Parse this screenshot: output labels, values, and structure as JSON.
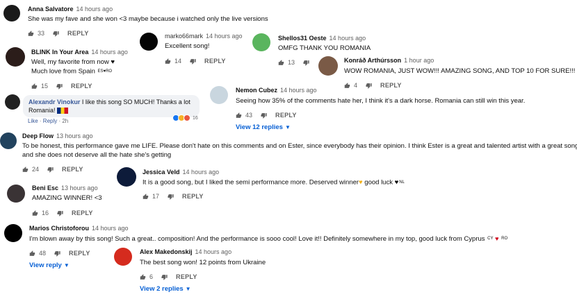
{
  "comments": [
    {
      "author": "Anna Salvatore",
      "time": "14 hours ago",
      "text": "She was my fave and she won <3 maybe because i watched only the live versions",
      "likes": "33",
      "reply": "REPLY"
    },
    {
      "author": "marko66mark",
      "time": "14 hours ago",
      "text": "Excellent song!",
      "likes": "14",
      "reply": "REPLY"
    },
    {
      "author": "Shellos31 Oeste",
      "time": "14 hours ago",
      "text": "OMFG THANK YOU ROMANIA",
      "likes": "13",
      "reply": ""
    },
    {
      "author": "BLINK In Your Area",
      "time": "14 hours ago",
      "text": "Well, my favorite from now ♥",
      "text2": "Much love from Spain",
      "tag": "ES♥RO",
      "likes": "15",
      "reply": "REPLY"
    },
    {
      "author": "Konráð Arthúrsson",
      "time": "1 hour ago",
      "text": "WOW ROMANIA, JUST WOW!!! AMAZING SONG, AND TOP 10 FOR SURE!!!",
      "likes": "4",
      "reply": "REPLY"
    },
    {
      "author": "Nemon Cubez",
      "time": "14 hours ago",
      "text": "Seeing how 35% of the comments hate her, I think it's a dark horse. Romania can still win this year.",
      "likes": "43",
      "reply": "REPLY",
      "view": "View 12 replies"
    },
    {
      "author": "Deep Flow",
      "time": "13 hours ago",
      "text": "To be honest, this performance gave me LIFE. Please don't hate on this comments and on Ester, since everybody has their opinion. I think Ester is a great and talented artist with a great song,",
      "text2": "and she does not deserve all the hate she's getting",
      "likes": "24",
      "reply": "REPLY"
    },
    {
      "author": "Jessica Veld",
      "time": "14 hours ago",
      "text": "It is a good song, but I liked the semi performance more. Deserved winner",
      "text_b": "good luck",
      "tag": "NL",
      "likes": "17",
      "reply": "REPLY"
    },
    {
      "author": "Beni Esc",
      "time": "13 hours ago",
      "text": "AMAZING WINNER! <3",
      "likes": "16",
      "reply": "REPLY"
    },
    {
      "author": "Marios Christoforou",
      "time": "14 hours ago",
      "text": "I'm blown away by this song! Such a great.. composition! And the performance is sooo cool! Love it!! Definitely somewhere in my top, good luck from Cyprus",
      "tag": "CY",
      "tag2": "RO",
      "likes": "48",
      "reply": "REPLY",
      "view": "View reply"
    },
    {
      "author": "Alex Makedonskij",
      "time": "14 hours ago",
      "text": "The best song won! 12 points from Ukraine",
      "likes": "6",
      "reply": "REPLY",
      "view": "View 2 replies"
    }
  ],
  "facebook": {
    "author": "Alexandr Vinokur",
    "text": "I like this song SO MUCH! Thanks a lot Romania!",
    "like": "Like",
    "reply": "Reply",
    "time": "2h",
    "count": "16"
  },
  "icons": {
    "like": "thumbs-up-icon",
    "dislike": "thumbs-down-icon",
    "chevron": "chevron-down-icon",
    "heart": "heart-icon",
    "flag": "romania-flag-icon"
  },
  "colors": {
    "link": "#065fd4",
    "heart": "#d0021b",
    "fb_link": "#385898"
  }
}
